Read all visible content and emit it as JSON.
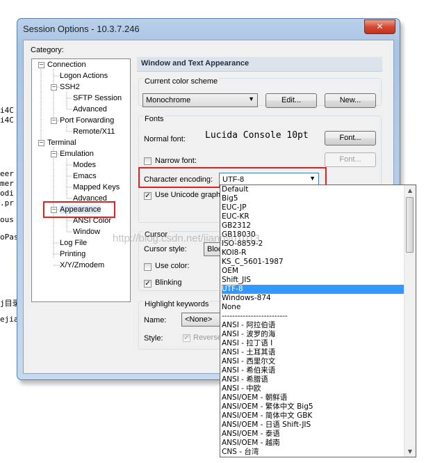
{
  "background": {
    "lines": [
      "i4C",
      "i4C",
      "eer",
      "mer",
      "odi",
      ".pr",
      "ous",
      "oPas",
      "j目录",
      "ejia"
    ]
  },
  "window": {
    "title": "Session Options - 10.3.7.246",
    "close_glyph": "✕"
  },
  "category": {
    "label": "Category:",
    "items": [
      {
        "label": "Connection",
        "expander": "−"
      },
      {
        "label": "Logon Actions"
      },
      {
        "label": "SSH2",
        "expander": "−"
      },
      {
        "label": "SFTP Session"
      },
      {
        "label": "Advanced"
      },
      {
        "label": "Port Forwarding",
        "expander": "−"
      },
      {
        "label": "Remote/X11"
      },
      {
        "label": "Terminal",
        "expander": "−"
      },
      {
        "label": "Emulation",
        "expander": "−"
      },
      {
        "label": "Modes"
      },
      {
        "label": "Emacs"
      },
      {
        "label": "Mapped Keys"
      },
      {
        "label": "Advanced"
      },
      {
        "label": "Appearance",
        "expander": "−"
      },
      {
        "label": "ANSI Color"
      },
      {
        "label": "Window"
      },
      {
        "label": "Log File"
      },
      {
        "label": "Printing"
      },
      {
        "label": "X/Y/Zmodem"
      }
    ]
  },
  "panel": {
    "title": "Window and Text Appearance",
    "color_scheme": {
      "label": "Current color scheme",
      "value": "Monochrome",
      "edit_button": "Edit...",
      "new_button": "New..."
    },
    "fonts": {
      "label": "Fonts",
      "normal_font_label": "Normal font:",
      "normal_font_value": "Lucida Console 10pt",
      "font_button": "Font...",
      "narrow_font_label": "Narrow font:",
      "narrow_font_button": "Font...",
      "encoding_label": "Character encoding:",
      "encoding_value": "UTF-8",
      "unicode_label": "Use Unicode graphi"
    },
    "cursor": {
      "label": "Cursor",
      "style_label": "Cursor style:",
      "style_value": "Bloc",
      "use_color_label": "Use color:",
      "blinking_label": "Blinking"
    },
    "highlight": {
      "label": "Highlight keywords",
      "name_label": "Name:",
      "name_value": "<None>",
      "style_label": "Style:",
      "reverse_label": "Reverse"
    }
  },
  "dropdown": {
    "options": [
      "Default",
      "Big5",
      "EUC-JP",
      "EUC-KR",
      "GB2312",
      "GB18030",
      "ISO-8859-2",
      "KOI8-R",
      "KS_C_5601-1987",
      "OEM",
      "Shift_JIS",
      "UTF-8",
      "Windows-874",
      "None",
      "-------------------------",
      "ANSI - 阿拉伯语",
      "ANSI - 波罗的海",
      "ANSI - 拉丁语 I",
      "ANSI - 土耳其语",
      "ANSI - 西里尔文",
      "ANSI - 希伯来语",
      "ANSI - 希腊语",
      "ANSI - 中欧",
      "ANSI/OEM - 朝鲜语",
      "ANSI/OEM - 繁体中文 Big5",
      "ANSI/OEM - 简体中文 GBK",
      "ANSI/OEM - 日语 Shift-JIS",
      "ANSI/OEM - 泰语",
      "ANSI/OEM - 越南",
      "CNS - 台湾"
    ],
    "selected": "UTF-8"
  },
  "watermark": "http://blog.csdn.net/jiangyu1013",
  "colors": {
    "selection": "#3399ff",
    "highlight_box": "#e02020"
  }
}
